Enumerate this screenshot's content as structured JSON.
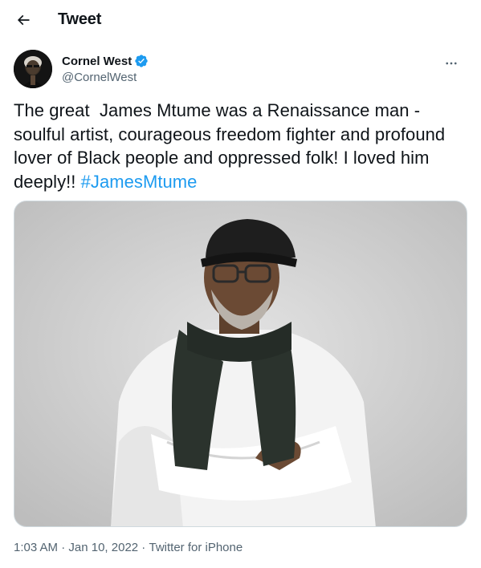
{
  "header": {
    "back_icon": "arrow-left-icon",
    "title": "Tweet"
  },
  "author": {
    "display_name": "Cornel West",
    "handle": "@CornelWest",
    "verified": true,
    "verified_color": "#1d9bf0"
  },
  "tweet": {
    "text": "The great  James Mtume was a Renaissance man - soulful artist, courageous freedom fighter and profound lover of Black people and oppressed folk! I loved him deeply!! ",
    "hashtag": "#JamesMtume",
    "hashtag_color": "#1d9bf0"
  },
  "media": {
    "type": "photo"
  },
  "meta": {
    "time": "1:03 AM",
    "separator": " · ",
    "date": "Jan 10, 2022",
    "source": "Twitter for iPhone"
  }
}
